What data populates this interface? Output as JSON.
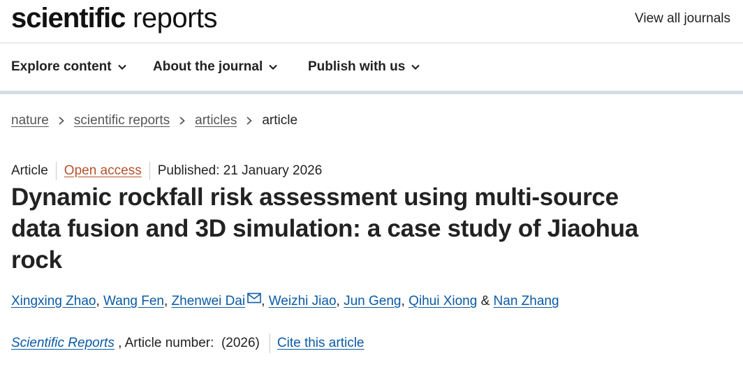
{
  "header": {
    "logo_bold": "scientific",
    "logo_light": "reports",
    "view_all": "View all journals"
  },
  "nav": {
    "items": [
      {
        "label": "Explore content"
      },
      {
        "label": "About the journal"
      },
      {
        "label": "Publish with us"
      }
    ]
  },
  "breadcrumb": {
    "items": [
      "nature",
      "scientific reports",
      "articles"
    ],
    "current": "article"
  },
  "article": {
    "type": "Article",
    "access": "Open access",
    "published": "Published: 21 January 2026",
    "title": "Dynamic rockfall risk assessment using multi-source data fusion and 3D simulation: a case study of Jiaohua rock",
    "authors": [
      "Xingxing Zhao",
      "Wang Fen",
      "Zhenwei Dai",
      "Weizhi Jiao",
      "Jun Geng",
      "Qihui Xiong",
      "Nan Zhang"
    ],
    "author_separator": ", ",
    "author_final_separator": " & ",
    "journal": "Scientific Reports",
    "article_number": " , Article number:  (2026)",
    "cite_label": "Cite this article"
  },
  "icons": {
    "chevron": "chevron-down-icon",
    "breadcrumb_sep": "chevron-right-icon",
    "mail": "mail-icon"
  },
  "colors": {
    "link": "#0b5aa5",
    "open_access": "#b4522a",
    "nav_border": "#d4dde5"
  }
}
